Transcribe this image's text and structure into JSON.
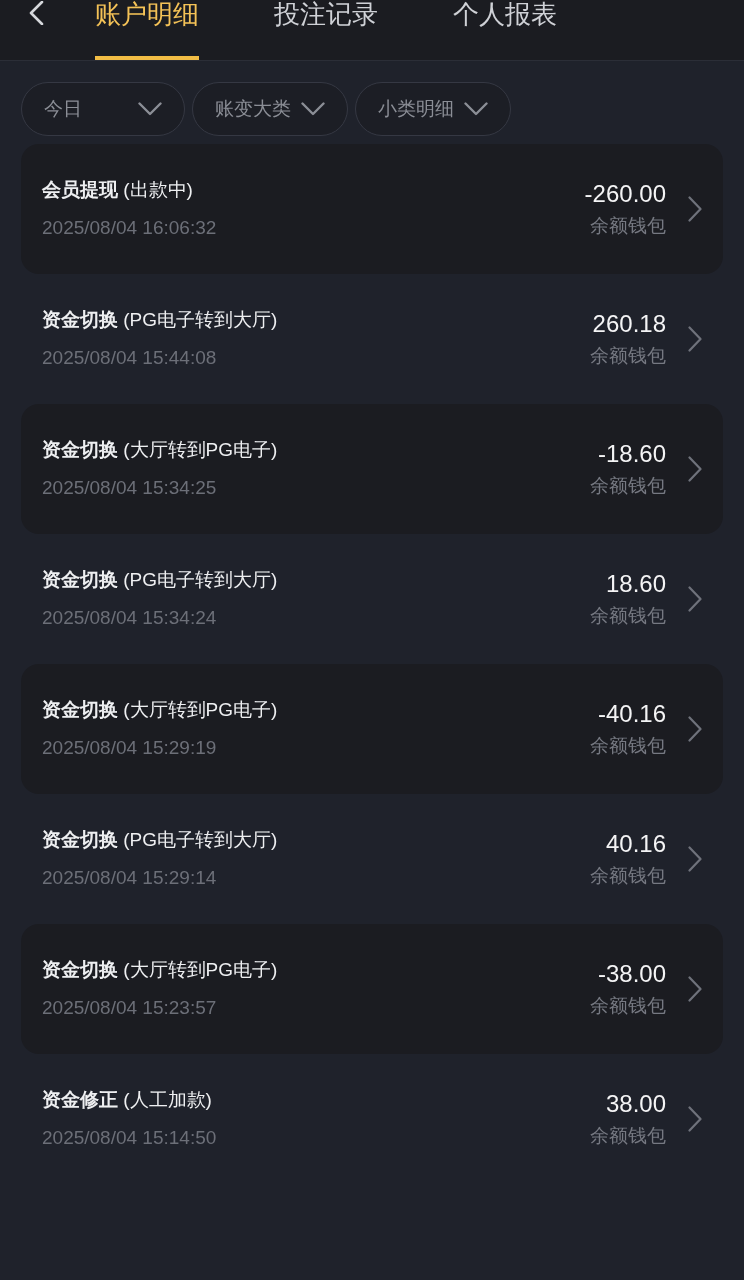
{
  "tabs": [
    {
      "label": "账户明细",
      "selected": true
    },
    {
      "label": "投注记录",
      "selected": false
    },
    {
      "label": "个人报表",
      "selected": false
    }
  ],
  "filters": [
    {
      "label": "今日"
    },
    {
      "label": "账变大类"
    },
    {
      "label": "小类明细"
    }
  ],
  "records": [
    {
      "title": "**会员提现** (出款中)",
      "time": "2025/08/04 16:06:32",
      "amount": "-260.00",
      "wallet": "余额钱包"
    },
    {
      "title": "**资金切换** (PG电子转到大厅)",
      "time": "2025/08/04 15:44:08",
      "amount": "260.18",
      "wallet": "余额钱包"
    },
    {
      "title": "**资金切换** (大厅转到PG电子)",
      "time": "2025/08/04 15:34:25",
      "amount": "-18.60",
      "wallet": "余额钱包"
    },
    {
      "title": "**资金切换** (PG电子转到大厅)",
      "time": "2025/08/04 15:34:24",
      "amount": "18.60",
      "wallet": "余额钱包"
    },
    {
      "title": "**资金切换** (大厅转到PG电子)",
      "time": "2025/08/04 15:29:19",
      "amount": "-40.16",
      "wallet": "余额钱包"
    },
    {
      "title": "**资金切换** (PG电子转到大厅)",
      "time": "2025/08/04 15:29:14",
      "amount": "40.16",
      "wallet": "余额钱包"
    },
    {
      "title": "**资金切换** (大厅转到PG电子)",
      "time": "2025/08/04 15:23:57",
      "amount": "-38.00",
      "wallet": "余额钱包"
    },
    {
      "title": "**资金修正** (人工加款)",
      "time": "2025/08/04 15:14:50",
      "amount": "38.00",
      "wallet": "余额钱包"
    }
  ]
}
